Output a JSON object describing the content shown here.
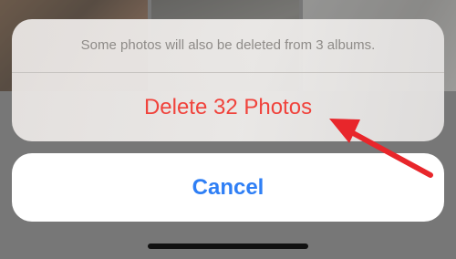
{
  "action_sheet": {
    "message": "Some photos will also be deleted from 3 albums.",
    "delete_label": "Delete 32 Photos",
    "cancel_label": "Cancel"
  },
  "colors": {
    "destructive": "#f0433c",
    "accent": "#2f7ff5",
    "annotation_arrow": "#e8262b"
  },
  "icons": {
    "annotation": "red-arrow-icon"
  }
}
